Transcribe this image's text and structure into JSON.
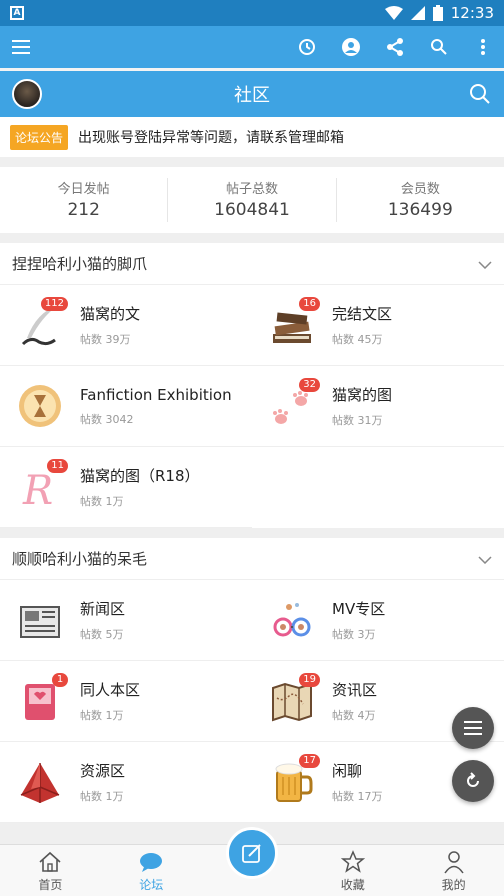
{
  "status": {
    "time": "12:33"
  },
  "header": {
    "title": "社区"
  },
  "notice": {
    "tag": "论坛公告",
    "text": "出现账号登陆异常等问题，请联系管理邮箱"
  },
  "stats": [
    {
      "label": "今日发帖",
      "value": "212"
    },
    {
      "label": "帖子总数",
      "value": "1604841"
    },
    {
      "label": "会员数",
      "value": "136499"
    }
  ],
  "sections": [
    {
      "title": "捏捏哈利小猫的脚爪",
      "forums": [
        {
          "name": "猫窝的文",
          "count": "帖数 39万",
          "badge": "112",
          "icon": "quill-icon"
        },
        {
          "name": "完结文区",
          "count": "帖数 45万",
          "badge": "16",
          "icon": "books-icon"
        },
        {
          "name": "Fanfiction Exhibition",
          "count": "帖数 3042",
          "badge": "",
          "icon": "hourglass-icon"
        },
        {
          "name": "猫窝的图",
          "count": "帖数 31万",
          "badge": "32",
          "icon": "paw-icon"
        },
        {
          "name": "猫窝的图（R18）",
          "count": "帖数 1万",
          "badge": "11",
          "icon": "r-letter-icon"
        }
      ]
    },
    {
      "title": "顺顺哈利小猫的呆毛",
      "forums": [
        {
          "name": "新闻区",
          "count": "帖数 5万",
          "badge": "",
          "icon": "newspaper-icon"
        },
        {
          "name": "MV专区",
          "count": "帖数 3万",
          "badge": "",
          "icon": "glasses-icon"
        },
        {
          "name": "同人本区",
          "count": "帖数 1万",
          "badge": "1",
          "icon": "book-heart-icon"
        },
        {
          "name": "资讯区",
          "count": "帖数 4万",
          "badge": "19",
          "icon": "map-icon"
        },
        {
          "name": "资源区",
          "count": "帖数 1万",
          "badge": "",
          "icon": "gem-icon"
        },
        {
          "name": "闲聊",
          "count": "帖数 17万",
          "badge": "17",
          "icon": "beer-mug-icon"
        }
      ]
    }
  ],
  "nav": [
    {
      "label": "首页",
      "icon": "home-icon"
    },
    {
      "label": "论坛",
      "icon": "chat-bubble-icon",
      "active": true
    },
    {
      "label": "收藏",
      "icon": "star-icon"
    },
    {
      "label": "我的",
      "icon": "user-icon"
    }
  ],
  "colors": {
    "primary": "#3ea3e3",
    "badge": "#e8483d",
    "noticeTag": "#f5a623"
  }
}
